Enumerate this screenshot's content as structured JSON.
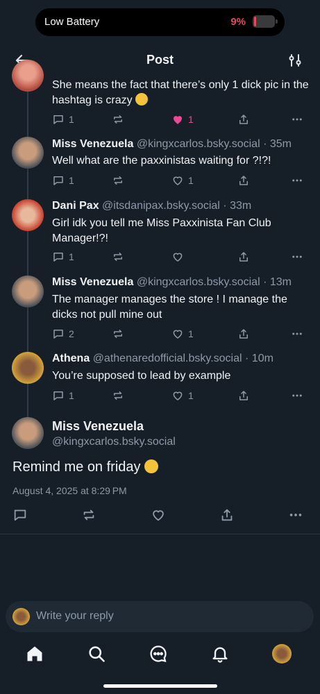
{
  "status_bar": {
    "label": "Low Battery",
    "battery_percent": "9%",
    "battery_level": 0.09,
    "accent": "#e64a59"
  },
  "header": {
    "title": "Post",
    "back_icon": "arrow-left-icon",
    "settings_icon": "sliders-icon"
  },
  "replies": [
    {
      "text": "She means the fact that there’s only 1 dick pic in the hashtag is crazy",
      "emoji": "😭",
      "reply_count": "1",
      "like_count": "1",
      "liked": true
    },
    {
      "name": "Miss Venezuela",
      "handle": "@kingxcarlos.bsky.social",
      "time": "· 35m",
      "text": "Well what are the paxxinistas waiting for ?!?!",
      "reply_count": "1",
      "like_count": "1"
    },
    {
      "name": "Dani Pax",
      "handle": "@itsdanipax.bsky.social",
      "time": "· 33m",
      "text": "Girl idk you tell me Miss Paxxinista Fan Club Manager!?!",
      "reply_count": "1",
      "like_count": ""
    },
    {
      "name": "Miss Venezuela",
      "handle": "@kingxcarlos.bsky.social",
      "time": "· 13m",
      "text": "The manager manages the store ! I manage the dicks not pull mine out",
      "reply_count": "2",
      "like_count": "1"
    },
    {
      "name": "Athena",
      "handle": "@athenaredofficial.bsky.social",
      "time": "· 10m",
      "text": "You’re supposed to lead by example",
      "reply_count": "1",
      "like_count": "1"
    }
  ],
  "main_post": {
    "name": "Miss Venezuela",
    "handle": "@kingxcarlos.bsky.social",
    "text": "Remind me on friday",
    "emoji": "🤫",
    "date": "August 4, 2025 at 8:29 PM"
  },
  "reply_box": {
    "placeholder": "Write your reply"
  },
  "tab_bar": {
    "items": [
      "home-icon",
      "search-icon",
      "chat-icon",
      "bell-icon",
      "profile-avatar"
    ]
  },
  "colors": {
    "background": "#161e27",
    "muted": "#8d9aa8",
    "like": "#ec4899"
  }
}
